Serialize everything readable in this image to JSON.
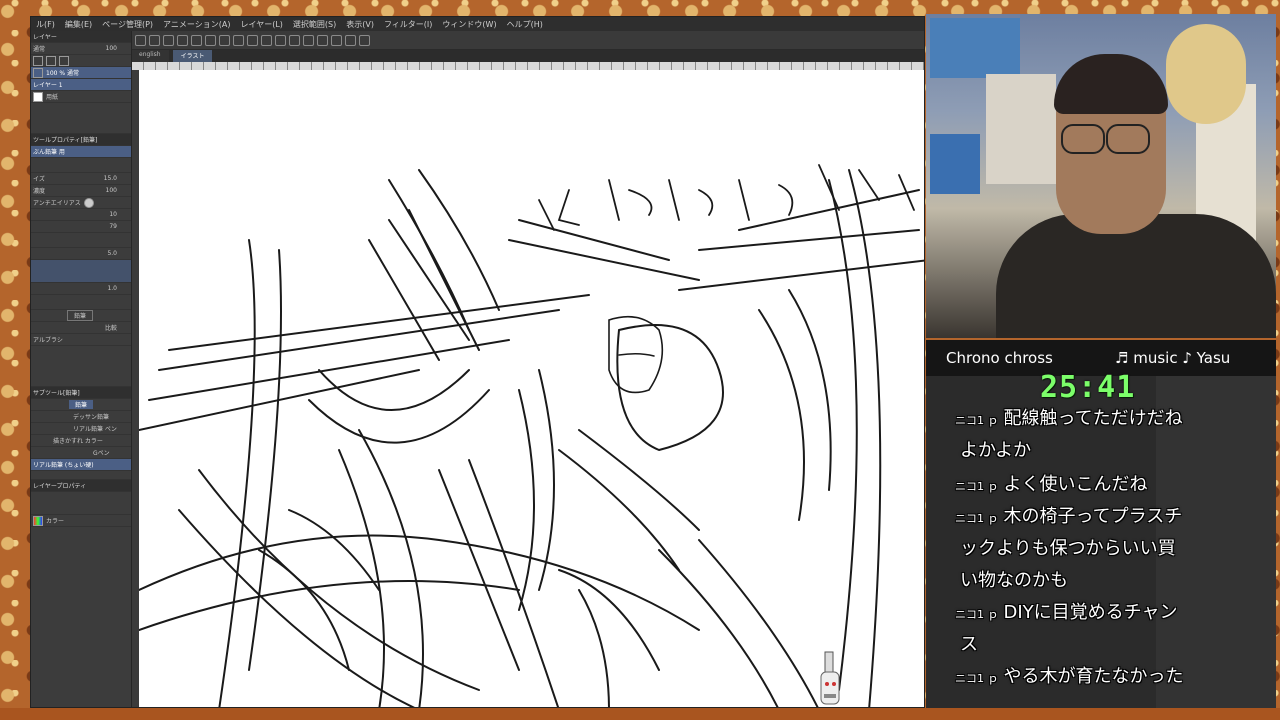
{
  "menu": [
    "ル(F)",
    "編集(E)",
    "ページ管理(P)",
    "アニメーション(A)",
    "レイヤー(L)",
    "選択範囲(S)",
    "表示(V)",
    "フィルター(I)",
    "ウィンドウ(W)",
    "ヘルプ(H)"
  ],
  "tabs": [
    "english",
    "イラスト"
  ],
  "left_panel": {
    "layer_label": "レイヤー",
    "blend": "通常",
    "opacity_val": "100",
    "layer_name": "100 % 通常",
    "layer_sub": "レイヤー 1",
    "paper_label": "用紙",
    "tool_header": "ツールプロパティ[鉛筆]",
    "sub_tool": "ぶん鉛筆 用",
    "size_label": "イズ",
    "size_val": "15.0",
    "density_label": "濃度",
    "density_val": "100",
    "aa_label": "アンチエイリアス",
    "val_10": "10",
    "val_79": "79",
    "val_5": "5.0",
    "val_1": "1.0",
    "pencil_label": "鉛筆",
    "compare_label": "比較",
    "brush_label": "アルブラシ",
    "subtool_header": "サブツール[鉛筆]",
    "pencil_tab": "鉛筆",
    "brushes": [
      "デッサン鉛筆",
      "リアル鉛筆 ペン",
      "描きかすれ カラー",
      "Gペン",
      "リアル鉛筆 (ちょい硬)"
    ],
    "layer_prop": "レイヤープロパティ",
    "color_label": "カラー"
  },
  "overlay": {
    "game": "Chrono chross",
    "music": "♬ music ♪ Yasu",
    "timer": "25:41"
  },
  "comments": [
    {
      "user": "ニコ1 ｐ",
      "text": "配線触ってただけだね"
    },
    {
      "user": "",
      "text": "よかよか"
    },
    {
      "user": "ニコ1 ｐ",
      "text": "よく使いこんだね"
    },
    {
      "user": "ニコ1 ｐ",
      "text": "木の椅子ってプラスチ"
    },
    {
      "user": "",
      "text": "ックよりも保つからいい買"
    },
    {
      "user": "",
      "text": "い物なのかも"
    },
    {
      "user": "ニコ1 ｐ",
      "text": "DIYに目覚めるチャン"
    },
    {
      "user": "",
      "text": "ス"
    },
    {
      "user": "ニコ1 ｐ",
      "text": "やる木が育たなかった"
    }
  ],
  "colors": {
    "timer": "#7cff6a",
    "accent": "#4b5f85"
  }
}
